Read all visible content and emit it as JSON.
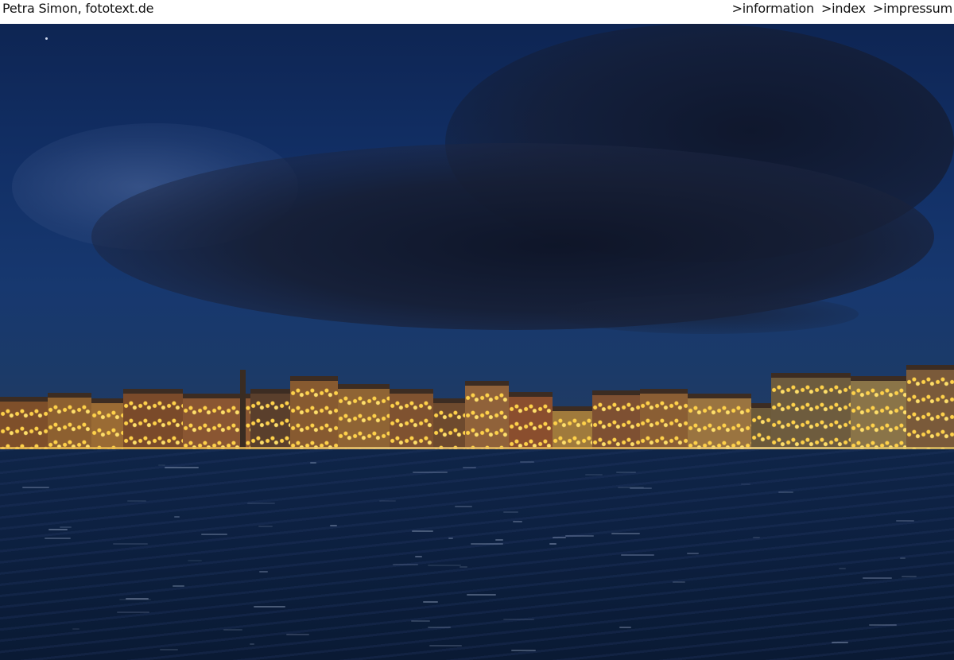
{
  "header": {
    "site_title": "Petra Simon, fototext.de",
    "nav": [
      {
        "label": ">information"
      },
      {
        "label": ">index"
      },
      {
        "label": ">impressum"
      }
    ]
  },
  "photo": {
    "alt_subject": "night-waterfront-photo"
  },
  "colors": {
    "header_bg": "#ffffff",
    "header_text": "#111111",
    "sky_blue": "#123067",
    "cloud_dark": "#161e34",
    "water_dark": "#0d2142",
    "lights": "#ffd24a"
  }
}
